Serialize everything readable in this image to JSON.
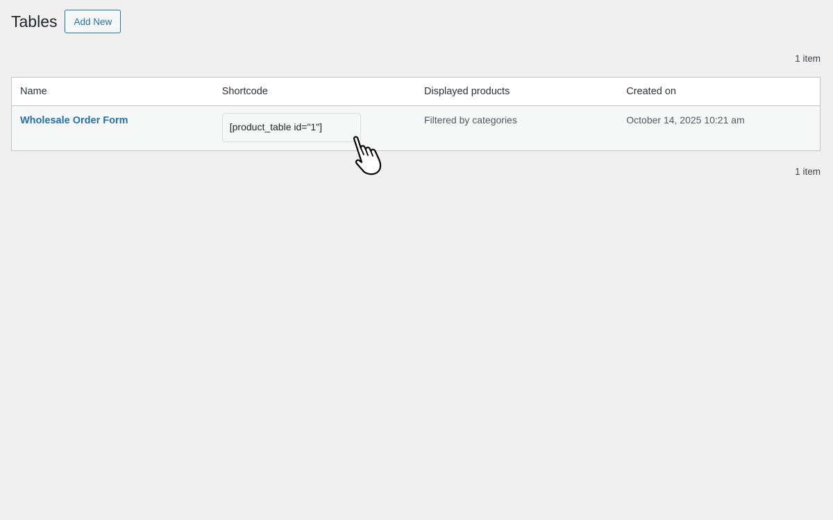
{
  "page": {
    "title": "Tables",
    "add_new_label": "Add New",
    "count_top": "1 item",
    "count_bottom": "1 item"
  },
  "table": {
    "columns": [
      "Name",
      "Shortcode",
      "Displayed products",
      "Created on"
    ],
    "rows": [
      {
        "name": "Wholesale Order Form",
        "shortcode": "[product_table id=\"1\"]",
        "displayed_products": "Filtered by categories",
        "created_on": "October 14, 2025 10:21 am"
      }
    ]
  },
  "cursor": {
    "icon": "hand-pointer-icon"
  }
}
